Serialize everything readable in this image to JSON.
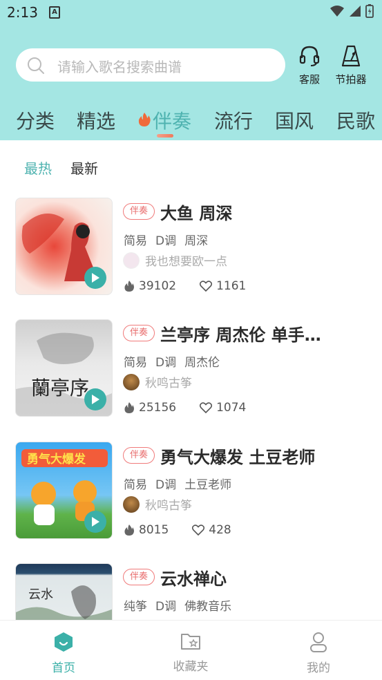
{
  "status": {
    "time": "2:13",
    "notif_label": "A"
  },
  "search": {
    "placeholder": "请输入歌名搜索曲谱"
  },
  "header_buttons": {
    "service_label": "客服",
    "metronome_label": "节拍器"
  },
  "categories": [
    {
      "label": "分类"
    },
    {
      "label": "精选"
    },
    {
      "label": "伴奏"
    },
    {
      "label": "流行"
    },
    {
      "label": "国风"
    },
    {
      "label": "民歌"
    }
  ],
  "subtabs": [
    {
      "label": "最热"
    },
    {
      "label": "最新"
    }
  ],
  "colors": {
    "accent": "#4fb3b0",
    "header_bg": "#a4e6e3",
    "tag": "#e86b6b"
  },
  "songs": [
    {
      "tag": "伴奏",
      "title": "大鱼 周深",
      "level": "简易",
      "key": "D调",
      "artist": "周深",
      "uploader": "我也想要欧一点",
      "plays": "39102",
      "likes": "1161"
    },
    {
      "tag": "伴奏",
      "title": "兰亭序 周杰伦 单手…",
      "level": "简易",
      "key": "D调",
      "artist": "周杰伦",
      "uploader": "秋鸣古筝",
      "plays": "25156",
      "likes": "1074"
    },
    {
      "tag": "伴奏",
      "title": "勇气大爆发 土豆老师",
      "level": "简易",
      "key": "D调",
      "artist": "土豆老师",
      "uploader": "秋鸣古筝",
      "plays": "8015",
      "likes": "428"
    },
    {
      "tag": "伴奏",
      "title": "云水禅心",
      "level": "纯筝",
      "key": "D调",
      "artist": "佛教音乐"
    }
  ],
  "bottom_nav": [
    {
      "label": "首页"
    },
    {
      "label": "收藏夹"
    },
    {
      "label": "我的"
    }
  ]
}
